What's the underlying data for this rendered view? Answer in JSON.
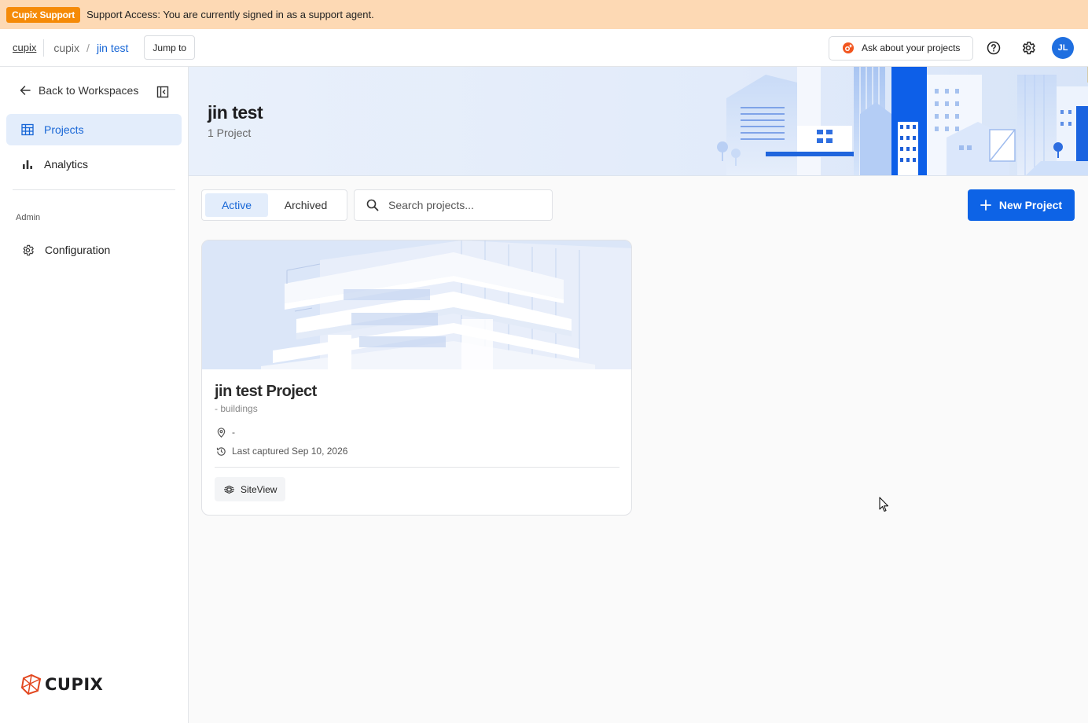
{
  "banner": {
    "badge": "Cupix Support",
    "message": "Support Access: You are currently signed in as a support agent."
  },
  "topbar": {
    "brand": "cupix",
    "breadcrumb": [
      "cupix",
      "jin test"
    ],
    "separator": "/",
    "jump_label": "Jump to",
    "ask_label": "Ask about your projects",
    "avatar_initials": "JL"
  },
  "sidebar": {
    "back_label": "Back to Workspaces",
    "items": [
      {
        "label": "Projects",
        "icon": "grid-table-icon",
        "active": true
      },
      {
        "label": "Analytics",
        "icon": "bar-chart-icon",
        "active": false
      }
    ],
    "admin_section": "Admin",
    "admin_items": [
      {
        "label": "Configuration",
        "icon": "gear-icon"
      }
    ],
    "logo_text": "CUPIX"
  },
  "header": {
    "title": "jin test",
    "subtitle": "1 Project"
  },
  "toolbar": {
    "tabs": [
      {
        "label": "Active",
        "active": true
      },
      {
        "label": "Archived",
        "active": false
      }
    ],
    "search_placeholder": "Search projects...",
    "new_project_label": "New Project"
  },
  "projects": [
    {
      "title": "jin test Project",
      "category": "- buildings",
      "location": "-",
      "last_captured": "Last captured Sep 10, 2026",
      "tag": "SiteView"
    }
  ],
  "colors": {
    "accent": "#0d63e6",
    "accent_soft": "#e3edfb",
    "banner_bg": "#fdd9b4",
    "badge_bg": "#f58a07"
  }
}
